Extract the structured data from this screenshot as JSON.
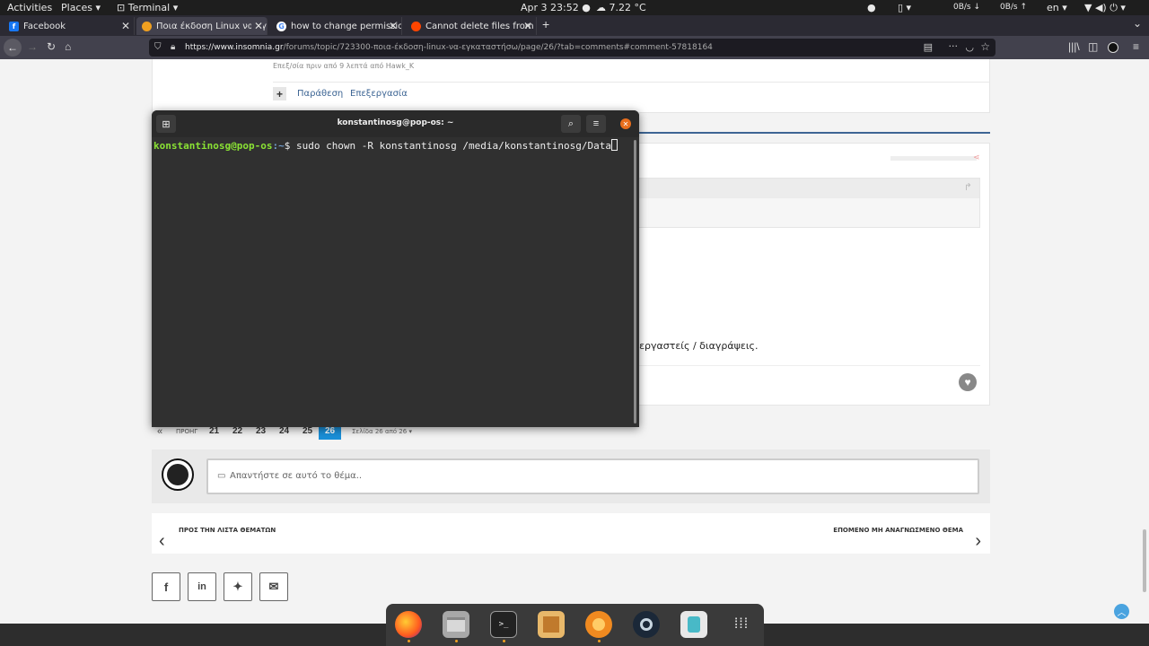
{
  "topbar": {
    "activities": "Activities",
    "places": "Places ▾",
    "app": "Terminal ▾",
    "clock": "Apr 3  23:52 ●",
    "weather": "7.22 °C",
    "net_down": "0B/s",
    "net_up": "0B/s",
    "lang": "en ▾"
  },
  "browser": {
    "tabs": [
      {
        "label": "Facebook"
      },
      {
        "label": "Ποια έκδοση Linux να εγκα"
      },
      {
        "label": "how to change permission"
      },
      {
        "label": "Cannot delete files from m"
      }
    ],
    "url_host": "https://www.insomnia.gr",
    "url_path": "/forums/topic/723300-ποια-έκδοση-linux-να-εγκαταστήσω/page/26/?tab=comments#comment-57818164"
  },
  "page": {
    "edited_note": "Επεξ/σία πριν από 9 λεπτά από Hawk_K",
    "quote_label": "Παράθεση",
    "edit_label": "Επεξεργασία",
    "post_text_fragment": "εξεργαστείς / διαγράψεις.",
    "pagination": {
      "prev": "«",
      "prev_label": "ΠΡΟΗΓ",
      "pages": [
        "21",
        "22",
        "23",
        "24",
        "25",
        "26"
      ],
      "current": "26",
      "page_of": "Σελίδα 26 από 26 ▾"
    },
    "reply_placeholder": "Απαντήστε σε αυτό το θέμα..",
    "back_to_list": "ΠΡΟΣ ΤΗΝ ΛΙΣΤΑ ΘΕΜΑΤΩΝ",
    "next_unread": "ΕΠΟΜΕΝΟ ΜΗ ΑΝΑΓΝΩΣΜΕΝΟ ΘΕΜΑ"
  },
  "terminal": {
    "title": "konstantinosg@pop-os: ~",
    "prompt_user": "konstantinosg@pop-os",
    "prompt_path": ":~",
    "prompt_symbol": "$ ",
    "command": "sudo chown -R konstantinosg /media/konstantinosg/Data"
  },
  "dock_apps": [
    "firefox-icon",
    "files-icon",
    "terminal-icon",
    "image-viewer-icon",
    "ubuntu-software-icon",
    "steam-icon",
    "pop-shop-icon",
    "app-grid-icon"
  ],
  "colors": {
    "prompt_green": "#8ae234",
    "prompt_blue": "#729fcf",
    "page_link": "#3d6594",
    "pagination_active": "#1a8fd8"
  }
}
